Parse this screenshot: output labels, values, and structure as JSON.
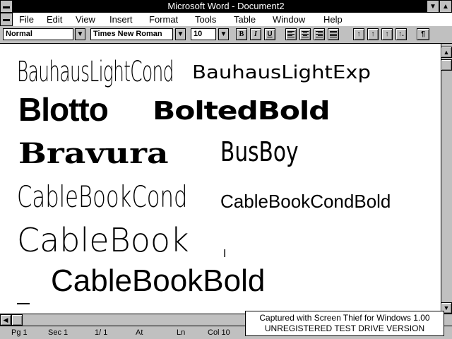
{
  "window": {
    "title": "Microsoft Word - Document2"
  },
  "menu": [
    "File",
    "Edit",
    "View",
    "Insert",
    "Format",
    "Tools",
    "Table",
    "Window",
    "Help"
  ],
  "toolbar": {
    "style": "Normal",
    "font": "Times New Roman",
    "size": "10",
    "bold": "B",
    "italic": "I",
    "underline": "U",
    "para_mark": "¶"
  },
  "samples": [
    "BauhausLightCond",
    "BauhausLightExp",
    "Blotto",
    "BoltedBold",
    "Bravura",
    "BusBoy",
    "CableBookCond",
    "CableBookCondBold",
    "CableBook",
    "CableBookBold"
  ],
  "status": {
    "page": "Pg 1",
    "section": "Sec 1",
    "pages": "1/ 1",
    "at": "At",
    "line": "Ln",
    "col": "Col 10"
  },
  "capture_notice": {
    "line1": "Captured with Screen Thief for Windows 1.00",
    "line2": "UNREGISTERED TEST DRIVE VERSION"
  }
}
